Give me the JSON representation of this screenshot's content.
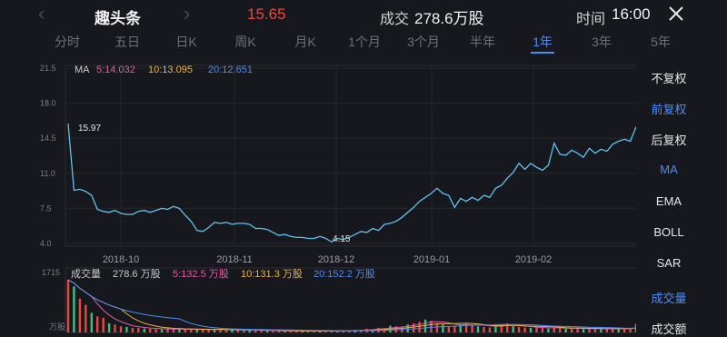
{
  "header": {
    "name": "趣头条",
    "price": "15.65",
    "volume_label": "成交",
    "volume_value": "278.6万股",
    "time_label": "时间",
    "time_value": "16:00"
  },
  "tabs": [
    "分时",
    "五日",
    "日K",
    "周K",
    "月K",
    "1个月",
    "3个月",
    "半年",
    "1年",
    "3年",
    "5年"
  ],
  "active_tab": "1年",
  "side_menu": [
    "不复权",
    "前复权",
    "后复权",
    "MA",
    "EMA",
    "BOLL",
    "SAR",
    "成交量",
    "成交额"
  ],
  "active_side": [
    "前复权",
    "MA",
    "成交量"
  ],
  "colors": {
    "accent": "#4d8cf5",
    "up": "#e8493f",
    "ma5": "#e25aa5",
    "ma10": "#e9b24a",
    "ma20": "#4d8cf5",
    "bg": "#17181d"
  },
  "chart_data": {
    "type": "line",
    "ma_legend": {
      "label": "MA",
      "ma5": "5:14.032",
      "ma10": "10:13.095",
      "ma20": "20:12.651"
    },
    "y_ticks": [
      "21.5",
      "18.0",
      "14.5",
      "11.0",
      "7.5",
      "4.0"
    ],
    "ylim": [
      4.0,
      21.5
    ],
    "x_labels": [
      "2018-10",
      "2018-11",
      "2018-12",
      "2019-01",
      "2019-02"
    ],
    "annotations": {
      "max": "15.97",
      "min": "4.15"
    },
    "price": [
      15.97,
      9.3,
      9.4,
      9.2,
      8.8,
      7.4,
      7.2,
      7.1,
      7.3,
      7.0,
      6.9,
      6.9,
      7.2,
      7.3,
      7.1,
      7.3,
      7.5,
      7.4,
      7.7,
      7.5,
      6.8,
      6.2,
      5.3,
      5.2,
      5.6,
      6.1,
      6.0,
      6.1,
      5.9,
      6.0,
      6.0,
      5.9,
      5.5,
      5.5,
      5.4,
      5.1,
      4.8,
      4.9,
      4.7,
      4.6,
      4.6,
      4.5,
      4.5,
      4.7,
      4.5,
      4.15,
      4.5,
      4.4,
      4.6,
      4.9,
      5.2,
      5.1,
      5.5,
      5.3,
      5.9,
      6.0,
      6.2,
      6.6,
      7.1,
      7.6,
      8.2,
      8.6,
      9.0,
      9.5,
      9.0,
      8.8,
      7.6,
      8.5,
      8.2,
      8.6,
      8.3,
      8.8,
      8.6,
      9.5,
      9.8,
      10.5,
      11.1,
      12.0,
      11.4,
      12.0,
      11.6,
      11.3,
      11.8,
      14.0,
      12.9,
      12.8,
      13.3,
      13.0,
      12.6,
      13.5,
      13.0,
      13.4,
      13.2,
      13.9,
      14.2,
      14.4,
      14.2,
      15.65
    ],
    "volume": {
      "label": "成交量",
      "value": "278.6 万股",
      "ma5": "5:132.5 万股",
      "ma10": "10:131.3 万股",
      "ma20": "20:152.2 万股",
      "y_top": "1715",
      "y_unit": "万股",
      "bars": [
        1715,
        1500,
        1100,
        900,
        640,
        520,
        480,
        300,
        260,
        200,
        180,
        150,
        150,
        130,
        120,
        110,
        100,
        120,
        110,
        100,
        90,
        110,
        100,
        95,
        90,
        85,
        100,
        80,
        80,
        90,
        70,
        75,
        80,
        60,
        55,
        50,
        60,
        55,
        50,
        45,
        40,
        50,
        45,
        40,
        55,
        60,
        50,
        70,
        60,
        80,
        90,
        120,
        100,
        150,
        140,
        220,
        200,
        180,
        260,
        300,
        350,
        420,
        380,
        300,
        260,
        200,
        220,
        260,
        300,
        250,
        200,
        180,
        160,
        220,
        260,
        300,
        200,
        180,
        160,
        150,
        170,
        150,
        130,
        160,
        140,
        120,
        130,
        150,
        110,
        120,
        130,
        110,
        100,
        120,
        140,
        130,
        120,
        280
      ]
    }
  }
}
